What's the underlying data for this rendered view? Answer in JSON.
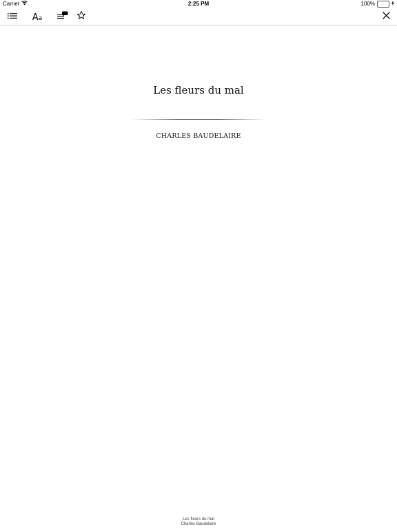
{
  "status_bar": {
    "carrier": "Carrier",
    "time": "2:25 PM",
    "battery_percent": "100%",
    "battery_level": 1.0,
    "icons": [
      "wifi-icon",
      "battery-icon",
      "charging-icon"
    ]
  },
  "toolbar": {
    "icons": [
      "table-of-contents-icon",
      "font-settings-icon",
      "notes-icon",
      "bookmark-star-icon",
      "close-icon"
    ],
    "font_settings_glyph_large": "A",
    "font_settings_glyph_small": "a"
  },
  "book": {
    "title": "Les fleurs du mal",
    "author": "CHARLES BAUDELAIRE"
  },
  "footer": {
    "title": "Les fleurs du mal",
    "author": "Charles Baudelaire"
  }
}
